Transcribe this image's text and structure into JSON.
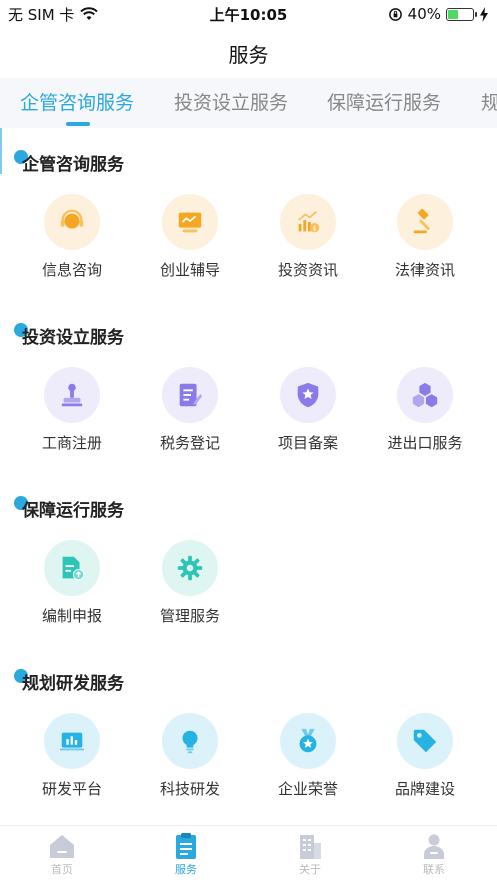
{
  "status": {
    "carrier": "无 SIM 卡",
    "time": "上午10:05",
    "battery": "40%",
    "battery_level": 0.4
  },
  "nav": {
    "title": "服务"
  },
  "tabs": [
    {
      "label": "企管咨询服务",
      "active": true
    },
    {
      "label": "投资设立服务",
      "active": false
    },
    {
      "label": "保障运行服务",
      "active": false
    },
    {
      "label": "规",
      "active": false
    }
  ],
  "sections": [
    {
      "title": "企管咨询服务",
      "items": [
        {
          "label": "信息咨询",
          "icon": "headset-icon"
        },
        {
          "label": "创业辅导",
          "icon": "monitor-icon"
        },
        {
          "label": "投资资讯",
          "icon": "investment-chart-icon"
        },
        {
          "label": "法律资讯",
          "icon": "gavel-icon"
        }
      ]
    },
    {
      "title": "投资设立服务",
      "items": [
        {
          "label": "工商注册",
          "icon": "stamp-icon"
        },
        {
          "label": "税务登记",
          "icon": "edit-form-icon"
        },
        {
          "label": "项目备案",
          "icon": "shield-star-icon"
        },
        {
          "label": "进出口服务",
          "icon": "cubes-icon"
        }
      ]
    },
    {
      "title": "保障运行服务",
      "items": [
        {
          "label": "编制申报",
          "icon": "document-upload-icon"
        },
        {
          "label": "管理服务",
          "icon": "gear-icon"
        }
      ]
    },
    {
      "title": "规划研发服务",
      "items": [
        {
          "label": "研发平台",
          "icon": "bar-chart-icon"
        },
        {
          "label": "科技研发",
          "icon": "lightbulb-icon"
        },
        {
          "label": "企业荣誉",
          "icon": "medal-icon"
        },
        {
          "label": "品牌建设",
          "icon": "tag-icon"
        }
      ]
    }
  ],
  "bottom_tabs": [
    {
      "label": "首页",
      "icon": "home-icon",
      "active": false
    },
    {
      "label": "服务",
      "icon": "clipboard-icon",
      "active": true
    },
    {
      "label": "关于",
      "icon": "building-icon",
      "active": false
    },
    {
      "label": "联系",
      "icon": "person-icon",
      "active": false
    }
  ],
  "colors": {
    "accent": "#2aa8e0",
    "orange": "#f5a623",
    "purple": "#8b7be8",
    "teal": "#2ec4b6",
    "cyan": "#26b3e3"
  }
}
